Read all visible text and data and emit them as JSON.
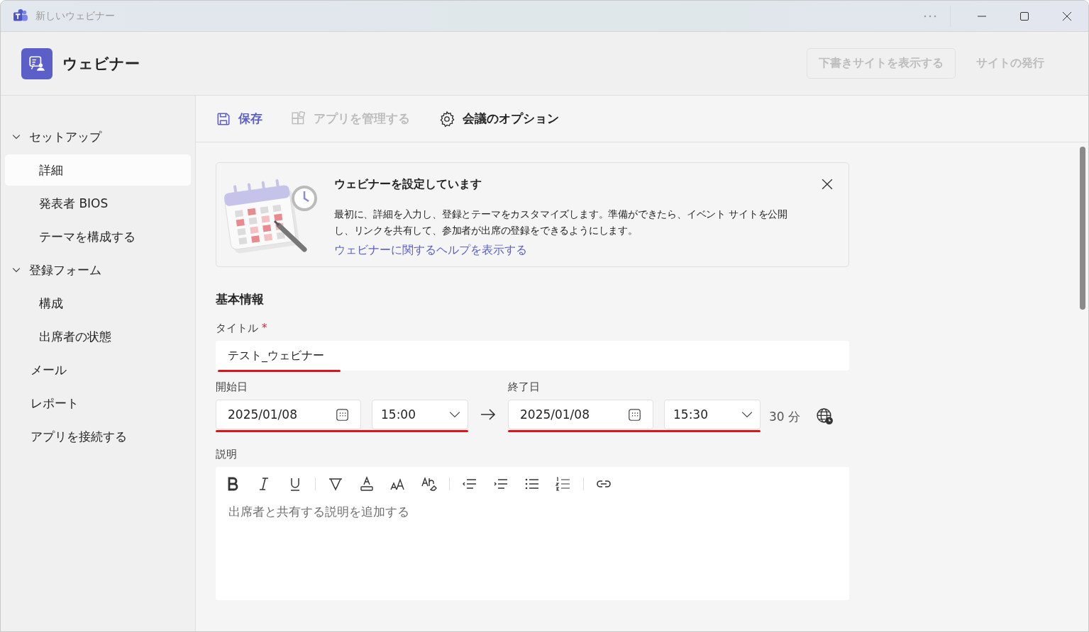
{
  "window": {
    "title": "新しいウェビナー"
  },
  "header": {
    "title": "ウェビナー",
    "buttons": [
      {
        "label": "下書きサイトを表示する",
        "kind": "outline",
        "disabled": true
      },
      {
        "label": "サイトの発行",
        "kind": "plain",
        "disabled": true
      }
    ]
  },
  "sidebar": {
    "items": [
      {
        "label": "セットアップ",
        "kind": "group",
        "expanded": true,
        "selected": false,
        "children": [
          {
            "label": "詳細",
            "selected": true
          },
          {
            "label": "発表者 BIOS",
            "selected": false
          },
          {
            "label": "テーマを構成する",
            "selected": false
          }
        ]
      },
      {
        "label": "登録フォーム",
        "kind": "group",
        "expanded": true,
        "selected": false,
        "children": [
          {
            "label": "構成",
            "selected": false
          },
          {
            "label": "出席者の状態",
            "selected": false
          }
        ]
      },
      {
        "label": "メール",
        "kind": "link",
        "selected": false
      },
      {
        "label": "レポート",
        "kind": "link",
        "selected": false
      },
      {
        "label": "アプリを接続する",
        "kind": "link",
        "selected": false
      }
    ]
  },
  "toolbar": [
    {
      "label": "保存",
      "kind": "save",
      "disabled": false
    },
    {
      "label": "アプリを管理する",
      "kind": "apps",
      "disabled": true
    },
    {
      "label": "会議のオプション",
      "kind": "options",
      "disabled": false
    }
  ],
  "banner": {
    "title": "ウェビナーを設定しています",
    "text": "最初に、詳細を入力し、登録とテーマをカスタマイズします。準備ができたら、イベント サイトを公開し、リンクを共有して、参加者が出席の登録をできるようにします。",
    "link": "ウェビナーに関するヘルプを表示する"
  },
  "form": {
    "section_title": "基本情報",
    "title_field": {
      "label": "タイトル",
      "required_mark": "*",
      "value": "テスト_ウェビナー",
      "marked": true
    },
    "start": {
      "label": "開始日",
      "date": "2025/01/08",
      "time": "15:00",
      "marked": true
    },
    "end": {
      "label": "終了日",
      "date": "2025/01/08",
      "time": "15:30",
      "marked": true
    },
    "duration": "30 分",
    "description": {
      "label": "説明",
      "placeholder": "出席者と共有する説明を追加する",
      "tools": [
        {
          "kind": "bold"
        },
        {
          "kind": "italic"
        },
        {
          "kind": "underline"
        },
        {
          "kind": "sep"
        },
        {
          "kind": "highlight"
        },
        {
          "kind": "font-color"
        },
        {
          "kind": "font-size"
        },
        {
          "kind": "clear-format"
        },
        {
          "kind": "sep"
        },
        {
          "kind": "outdent"
        },
        {
          "kind": "indent"
        },
        {
          "kind": "bullets"
        },
        {
          "kind": "numbering"
        },
        {
          "kind": "sep"
        },
        {
          "kind": "link"
        }
      ]
    }
  }
}
